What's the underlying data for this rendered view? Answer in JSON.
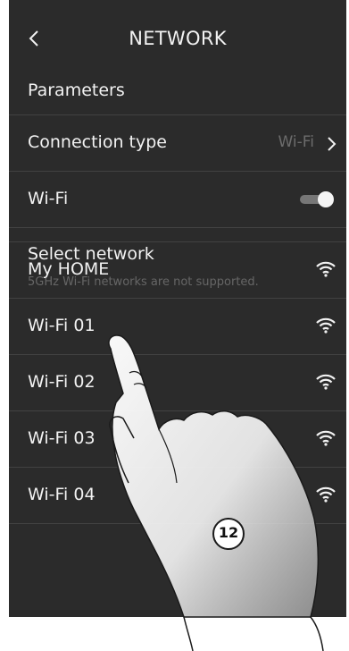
{
  "header": {
    "title": "NETWORK",
    "back_icon": "chevron-left-icon"
  },
  "section": {
    "title": "Parameters"
  },
  "connection_type": {
    "label": "Connection type",
    "value": "Wi-Fi",
    "icon": "chevron-right-icon"
  },
  "wifi_toggle": {
    "label": "Wi-Fi",
    "state": "on"
  },
  "select_network": {
    "label": "Select network",
    "hint": "5GHz Wi-Fi networks are not supported."
  },
  "networks": [
    {
      "name": "My HOME",
      "icon": "wifi-signal-icon"
    },
    {
      "name": "Wi-Fi 01",
      "icon": "wifi-signal-icon"
    },
    {
      "name": "Wi-Fi 02",
      "icon": "wifi-signal-icon"
    },
    {
      "name": "Wi-Fi 03",
      "icon": "wifi-signal-icon"
    },
    {
      "name": "Wi-Fi 04",
      "icon": "wifi-signal-icon"
    }
  ],
  "callout": {
    "number": "12"
  },
  "colors": {
    "screen_bg": "#2b2b2b",
    "text": "#f2f2f2",
    "muted": "#6c6c6c",
    "divider": "#424242"
  }
}
